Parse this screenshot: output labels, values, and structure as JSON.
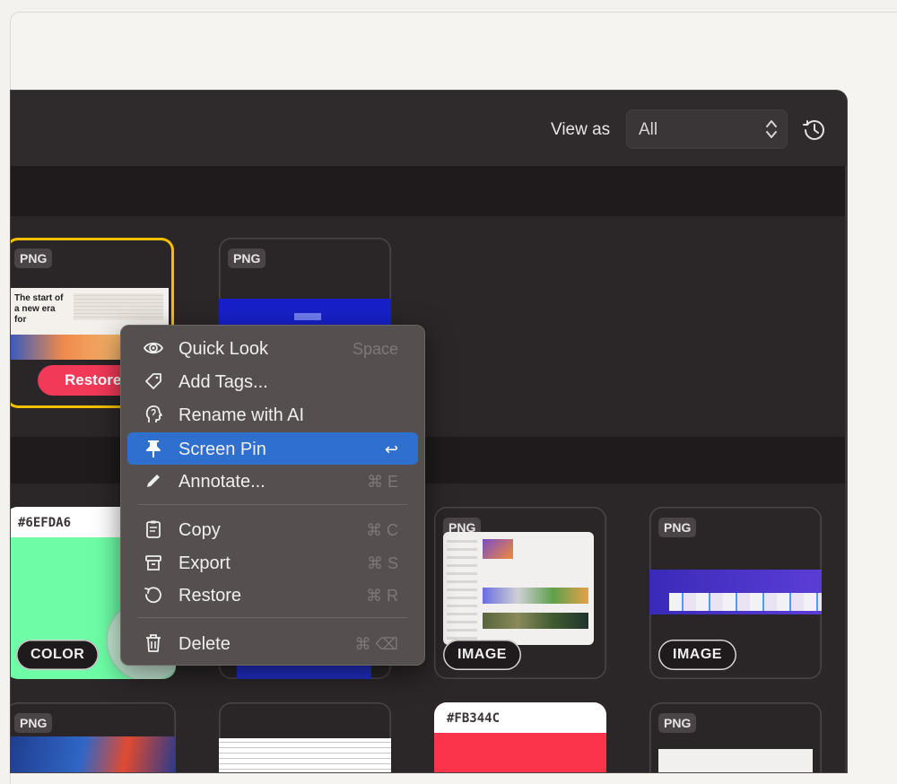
{
  "toolbar": {
    "view_as_label": "View as",
    "view_select_value": "All",
    "icons": [
      "updown-chevron-icon",
      "history-clock-icon"
    ]
  },
  "cards": [
    {
      "badge": "PNG",
      "button": "Restore",
      "preview_text": "The start of a new era for"
    },
    {
      "badge": "PNG"
    },
    {
      "hex": "#6EFDA6",
      "pill": "COLOR",
      "swatch_color": "#6efda6"
    },
    {
      "badge": "PNG",
      "pill": "IMAGE"
    },
    {
      "badge": "PNG",
      "pill": "IMAGE"
    },
    {
      "badge": "PNG"
    },
    {
      "hex": "#FB344C",
      "swatch_color": "#fb344c"
    },
    {
      "badge": "PNG"
    }
  ],
  "context_menu": {
    "items": [
      {
        "label": "Quick Look",
        "shortcut": "Space",
        "icon": "eye-icon"
      },
      {
        "label": "Add Tags...",
        "shortcut": "",
        "icon": "tag-icon"
      },
      {
        "label": "Rename with AI",
        "shortcut": "",
        "icon": "ai-brain-icon"
      },
      {
        "label": "Screen Pin",
        "shortcut": "↩",
        "icon": "pin-icon",
        "active": true
      },
      {
        "label": "Annotate...",
        "shortcut": "⌘ E",
        "icon": "pencil-icon"
      },
      {
        "label": "Copy",
        "shortcut": "⌘ C",
        "icon": "copy-icon"
      },
      {
        "label": "Export",
        "shortcut": "⌘ S",
        "icon": "export-icon"
      },
      {
        "label": "Restore",
        "shortcut": "⌘ R",
        "icon": "restore-icon"
      },
      {
        "label": "Delete",
        "shortcut": "⌘ ⌫",
        "icon": "trash-icon"
      }
    ]
  },
  "colors": {
    "window_bg": "#2b2628",
    "menu_bg": "#55504f",
    "menu_active": "#2f6fce",
    "selection_border": "#f6c000",
    "restore_button": "#f23a58"
  }
}
